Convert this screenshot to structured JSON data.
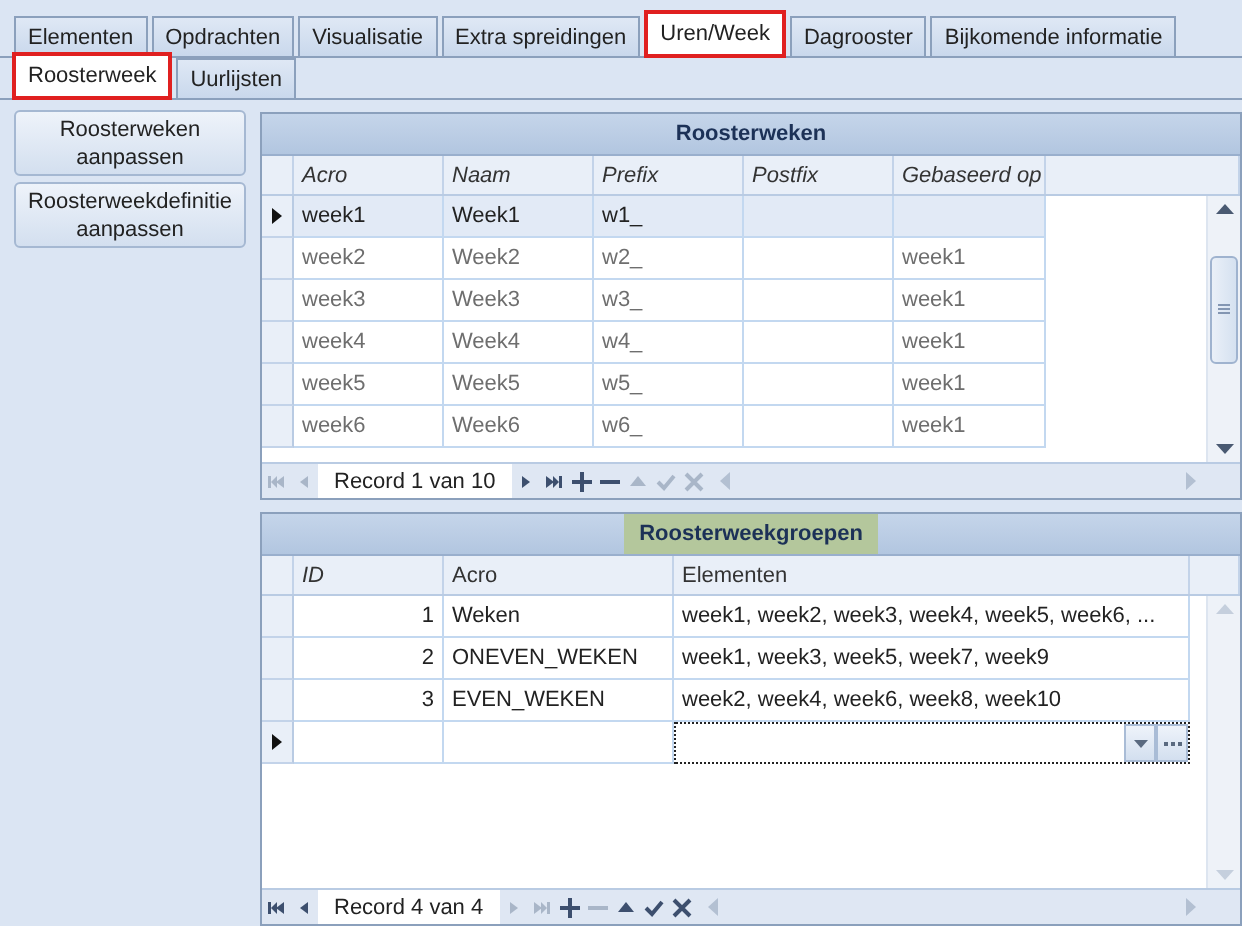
{
  "tabs": [
    {
      "label": "Elementen",
      "selected": false
    },
    {
      "label": "Opdrachten",
      "selected": false
    },
    {
      "label": "Visualisatie",
      "selected": false
    },
    {
      "label": "Extra spreidingen",
      "selected": false
    },
    {
      "label": "Uren/Week",
      "selected": true
    },
    {
      "label": "Dagrooster",
      "selected": false
    },
    {
      "label": "Bijkomende informatie",
      "selected": false
    }
  ],
  "subtabs": [
    {
      "label": "Roosterweek",
      "selected": true
    },
    {
      "label": "Uurlijsten",
      "selected": false
    }
  ],
  "side_buttons": [
    "Roosterweken aanpassen",
    "Roosterweekdefinitie aanpassen"
  ],
  "grids": [
    {
      "title": "Roosterweken",
      "title_highlighted": false,
      "columns": [
        {
          "label": "Acro",
          "read_only": true
        },
        {
          "label": "Naam",
          "read_only": true
        },
        {
          "label": "Prefix",
          "read_only": true
        },
        {
          "label": "Postfix",
          "read_only": true
        },
        {
          "label": "Gebaseerd op",
          "read_only": true
        }
      ],
      "rows": [
        {
          "selected": true,
          "kind": "data",
          "cells": [
            "week1",
            "Week1",
            "w1_",
            "",
            ""
          ]
        },
        {
          "selected": false,
          "kind": "data",
          "cells": [
            "week2",
            "Week2",
            "w2_",
            "",
            "week1"
          ]
        },
        {
          "selected": false,
          "kind": "data",
          "cells": [
            "week3",
            "Week3",
            "w3_",
            "",
            "week1"
          ]
        },
        {
          "selected": false,
          "kind": "data",
          "cells": [
            "week4",
            "Week4",
            "w4_",
            "",
            "week1"
          ]
        },
        {
          "selected": false,
          "kind": "data",
          "cells": [
            "week5",
            "Week5",
            "w5_",
            "",
            "week1"
          ]
        },
        {
          "selected": false,
          "kind": "data",
          "cells": [
            "week6",
            "Week6",
            "w6_",
            "",
            "week1"
          ]
        }
      ],
      "navigator": {
        "record": "Record 1 van 10",
        "buttons": [
          {
            "kind": "first",
            "disabled": true
          },
          {
            "kind": "prev",
            "disabled": true
          },
          {
            "kind": "next",
            "disabled": false
          },
          {
            "kind": "last",
            "disabled": false
          },
          {
            "kind": "append",
            "disabled": false
          },
          {
            "kind": "remove",
            "disabled": false
          },
          {
            "kind": "edit",
            "disabled": true
          },
          {
            "kind": "apply",
            "disabled": true
          },
          {
            "kind": "cancel",
            "disabled": true
          }
        ]
      }
    },
    {
      "title": "Roosterweekgroepen",
      "title_highlighted": true,
      "columns": [
        {
          "label": "ID",
          "read_only": true
        },
        {
          "label": "Acro",
          "read_only": false
        },
        {
          "label": "Elementen",
          "read_only": false
        }
      ],
      "rows": [
        {
          "selected": false,
          "kind": "data",
          "cells": [
            "1",
            "Weken",
            "week1, week2, week3, week4, week5, week6, ..."
          ]
        },
        {
          "selected": false,
          "kind": "data",
          "cells": [
            "2",
            "ONEVEN_WEKEN",
            "week1, week3, week5, week7, week9"
          ]
        },
        {
          "selected": false,
          "kind": "data",
          "cells": [
            "3",
            "EVEN_WEKEN",
            "week2, week4, week6, week8, week10"
          ]
        },
        {
          "selected": true,
          "kind": "new_row",
          "cells": [
            "",
            "",
            ""
          ]
        }
      ],
      "navigator": {
        "record": "Record 4 van 4",
        "buttons": [
          {
            "kind": "first",
            "disabled": false
          },
          {
            "kind": "prev",
            "disabled": false
          },
          {
            "kind": "next",
            "disabled": true
          },
          {
            "kind": "last",
            "disabled": true
          },
          {
            "kind": "append",
            "disabled": false
          },
          {
            "kind": "remove",
            "disabled": true
          },
          {
            "kind": "edit",
            "disabled": false
          },
          {
            "kind": "apply",
            "disabled": false
          },
          {
            "kind": "cancel",
            "disabled": false
          }
        ]
      }
    }
  ]
}
